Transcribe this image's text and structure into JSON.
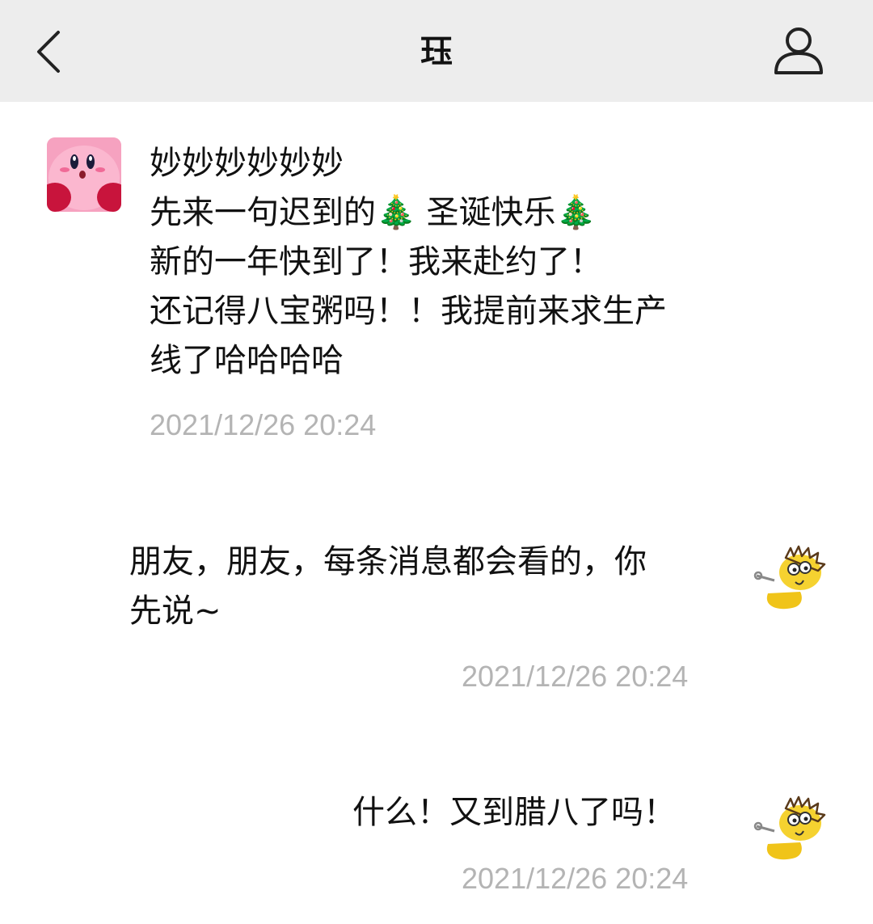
{
  "header": {
    "title": "珏",
    "back_icon": "chevron-left-icon",
    "profile_icon": "person-icon"
  },
  "messages": [
    {
      "side": "incoming",
      "sender": "妙妙妙妙妙妙",
      "avatar": "pink-round-character-avatar",
      "lines": [
        "先来一句迟到的🎄 圣诞快乐🎄",
        "新的一年快到了！我来赴约了！",
        "还记得八宝粥吗！！我提前来求生产",
        "线了哈哈哈哈"
      ],
      "time": "2021/12/26 20:24"
    },
    {
      "side": "outgoing",
      "avatar": "yellow-cartoon-avatar",
      "lines": [
        "朋友，朋友，每条消息都会看的，你",
        "先说~"
      ],
      "time": "2021/12/26 20:24"
    },
    {
      "side": "outgoing",
      "avatar": "yellow-cartoon-avatar",
      "lines": [
        "什么！又到腊八了吗！"
      ],
      "time": "2021/12/26 20:24"
    }
  ],
  "colors": {
    "header_bg": "#ededed",
    "timestamp": "#b4b4b4",
    "text": "#111111"
  }
}
